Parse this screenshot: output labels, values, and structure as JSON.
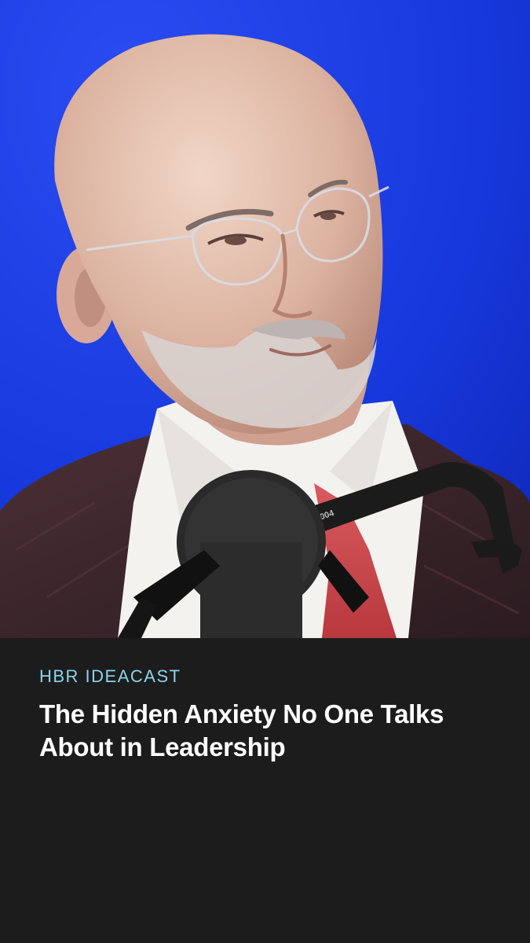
{
  "card": {
    "kicker": "HBR IDEACAST",
    "headline": "The Hidden Anxiety No One Talks About in Leadership"
  },
  "photo": {
    "microphone_label": "Model 3004",
    "colors": {
      "backdrop": "#1533d6",
      "caption_background": "#1c1c1c",
      "kicker_text": "#8cd2ec",
      "headline_text": "#ffffff"
    }
  }
}
